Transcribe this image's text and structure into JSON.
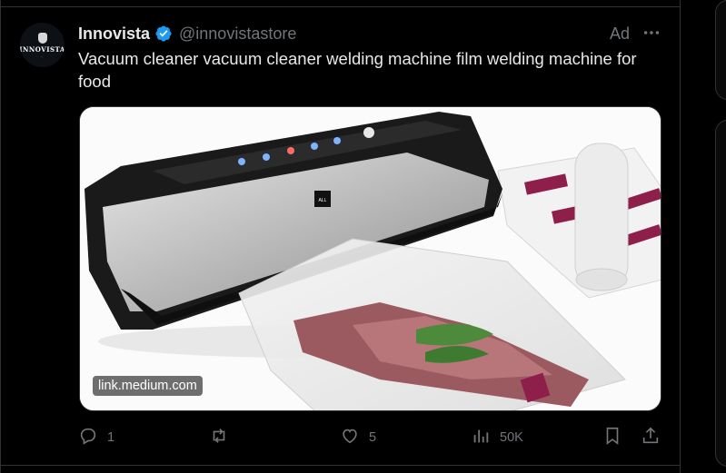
{
  "tweet": {
    "display_name": "Innovista",
    "handle": "@innovistastore",
    "ad_label": "Ad",
    "text": "Vacuum cleaner vacuum cleaner welding machine film welding machine for food",
    "avatar": {
      "logo_text": "INNOVISTA"
    },
    "media": {
      "link_label": "link.medium.com",
      "product_badge": "ALL CLAD"
    },
    "actions": {
      "reply_count": "1",
      "retweet_count": "",
      "like_count": "5",
      "views_count": "50K"
    }
  },
  "icons": {
    "verified": "verified-badge-icon",
    "more": "more-horizontal-icon",
    "reply": "reply-icon",
    "retweet": "retweet-icon",
    "like": "heart-icon",
    "views": "views-chart-icon",
    "bookmark": "bookmark-icon",
    "share": "share-icon"
  },
  "colors": {
    "verified": "#1d9bf0",
    "muted": "#71767b",
    "text": "#e7e9ea",
    "background": "#000000"
  }
}
